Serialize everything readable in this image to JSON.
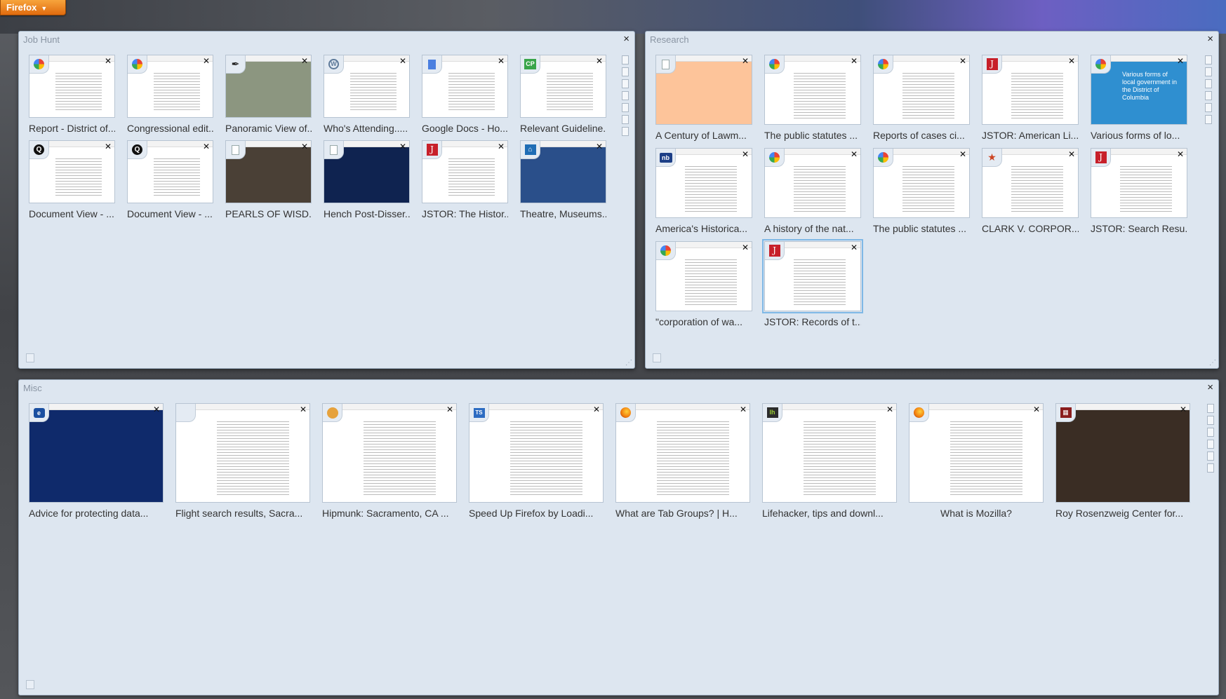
{
  "app": {
    "button_label": "Firefox"
  },
  "colors": {
    "panel": "#dde6f0",
    "firefox_orange": "#e8780f",
    "jstor_red": "#c7202a"
  },
  "groups": {
    "job_hunt": {
      "title": "Job Hunt",
      "close": "×",
      "tabs": [
        {
          "label": "Report - District of...",
          "icon": "google-icon",
          "thumb": "#ffffff"
        },
        {
          "label": "Congressional edit...",
          "icon": "google-icon",
          "thumb": "#ffffff"
        },
        {
          "label": "Panoramic View of...",
          "icon": "feather-icon",
          "thumb": "#8c9680"
        },
        {
          "label": "Who's Attending.....",
          "icon": "wordpress-icon",
          "thumb": "#ffffff"
        },
        {
          "label": "Google Docs - Ho...",
          "icon": "google-docs-icon",
          "thumb": "#ffffff"
        },
        {
          "label": "Relevant Guideline...",
          "icon": "cp-icon",
          "thumb": "#ffffff"
        },
        {
          "label": "Document View - ...",
          "icon": "q-icon",
          "thumb": "#ffffff"
        },
        {
          "label": "Document View - ...",
          "icon": "q-icon",
          "thumb": "#ffffff"
        },
        {
          "label": "PEARLS OF WISD...",
          "icon": "document-icon",
          "thumb": "#4a4036"
        },
        {
          "label": "Hench Post-Disser...",
          "icon": "document-icon",
          "thumb": "#0f2350"
        },
        {
          "label": "JSTOR: The Histor...",
          "icon": "jstor-icon",
          "thumb": "#ffffff"
        },
        {
          "label": "Theatre, Museums...",
          "icon": "home-icon",
          "thumb": "#2a4f8a"
        }
      ]
    },
    "research": {
      "title": "Research",
      "close": "×",
      "tabs": [
        {
          "label": "A Century of Lawm...",
          "icon": "document-icon",
          "thumb": "#fdc49a"
        },
        {
          "label": "The public statutes ...",
          "icon": "google-icon",
          "thumb": "#ffffff"
        },
        {
          "label": "Reports of cases ci...",
          "icon": "google-icon",
          "thumb": "#ffffff"
        },
        {
          "label": "JSTOR: American Li...",
          "icon": "jstor-icon",
          "thumb": "#ffffff"
        },
        {
          "label": "Various forms of lo...",
          "icon": "google-icon",
          "thumb": "#2f8fd0",
          "thumb_text": "Various forms of local government in the District of Columbia"
        },
        {
          "label": "America's Historica...",
          "icon": "nb-icon",
          "thumb": "#ffffff"
        },
        {
          "label": "A history of the nat...",
          "icon": "google-icon",
          "thumb": "#ffffff"
        },
        {
          "label": "The public statutes ...",
          "icon": "google-icon",
          "thumb": "#ffffff"
        },
        {
          "label": "CLARK V. CORPOR...",
          "icon": "star-icon",
          "thumb": "#ffffff"
        },
        {
          "label": "JSTOR: Search Resu...",
          "icon": "jstor-icon",
          "thumb": "#ffffff"
        },
        {
          "label": "\"corporation of wa...",
          "icon": "google-icon",
          "thumb": "#ffffff"
        },
        {
          "label": "JSTOR: Records of t...",
          "icon": "jstor-icon",
          "thumb": "#ffffff",
          "selected": true
        }
      ]
    },
    "misc": {
      "title": "Misc",
      "close": "×",
      "tabs": [
        {
          "label": "Advice for protecting data...",
          "icon": "ie-icon",
          "thumb": "#0f2a6b"
        },
        {
          "label": "Flight search results, Sacra...",
          "icon": "blank-icon",
          "thumb": "#ffffff"
        },
        {
          "label": "Hipmunk: Sacramento, CA ...",
          "icon": "hipmunk-icon",
          "thumb": "#ffffff"
        },
        {
          "label": "Speed Up Firefox by Loadi...",
          "icon": "ts-icon",
          "thumb": "#ffffff"
        },
        {
          "label": "What are Tab Groups? | H...",
          "icon": "firefox-icon",
          "thumb": "#ffffff"
        },
        {
          "label": "Lifehacker, tips and downl...",
          "icon": "lifehacker-icon",
          "thumb": "#ffffff"
        },
        {
          "label": "What is Mozilla?",
          "icon": "firefox-icon",
          "thumb": "#ffffff"
        },
        {
          "label": "Roy Rosenzweig Center for...",
          "icon": "chnm-icon",
          "thumb": "#3a2d24"
        }
      ]
    }
  }
}
